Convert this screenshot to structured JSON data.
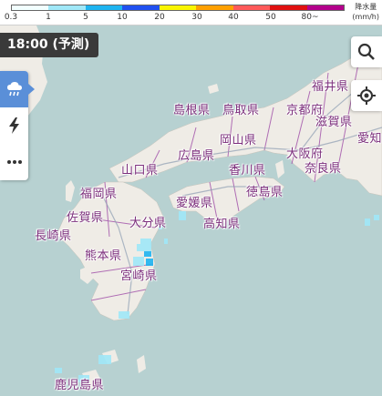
{
  "legend": {
    "ticks": [
      "0.3",
      "1",
      "5",
      "10",
      "20",
      "30",
      "40",
      "50",
      "80~"
    ],
    "unit_line1": "降水量",
    "unit_line2": "(mm/h)",
    "colors": [
      "#f2ffff",
      "#a0e8f8",
      "#1eb4f0",
      "#2050f0",
      "#faf500",
      "#ffa000",
      "#ff5a5a",
      "#e01010",
      "#b4008c"
    ]
  },
  "time_badge": "18:00 (予測)",
  "sidebar": {
    "rain_icon": "rain-cloud-icon",
    "lightning_icon": "lightning-icon",
    "more_icon": "more-icon"
  },
  "right_buttons": {
    "search_icon": "search-icon",
    "location_icon": "current-location-icon"
  },
  "prefectures": [
    {
      "id": "fukui",
      "label": "福井県"
    },
    {
      "id": "shimane",
      "label": "島根県"
    },
    {
      "id": "tottori",
      "label": "鳥取県"
    },
    {
      "id": "kyoto",
      "label": "京都府"
    },
    {
      "id": "shiga",
      "label": "滋賀県"
    },
    {
      "id": "aichi",
      "label": "愛知"
    },
    {
      "id": "okayama",
      "label": "岡山県"
    },
    {
      "id": "hiroshima",
      "label": "広島県"
    },
    {
      "id": "osaka",
      "label": "大阪府"
    },
    {
      "id": "nara",
      "label": "奈良県"
    },
    {
      "id": "yamaguchi",
      "label": "山口県"
    },
    {
      "id": "kagawa",
      "label": "香川県"
    },
    {
      "id": "fukuoka",
      "label": "福岡県"
    },
    {
      "id": "tokushima",
      "label": "徳島県"
    },
    {
      "id": "ehime",
      "label": "愛媛県"
    },
    {
      "id": "saga",
      "label": "佐賀県"
    },
    {
      "id": "oita",
      "label": "大分県"
    },
    {
      "id": "kochi",
      "label": "高知県"
    },
    {
      "id": "nagasaki",
      "label": "長崎県"
    },
    {
      "id": "kumamoto",
      "label": "熊本県"
    },
    {
      "id": "miyazaki",
      "label": "宮崎県"
    },
    {
      "id": "kagoshima",
      "label": "鹿児島県"
    }
  ]
}
